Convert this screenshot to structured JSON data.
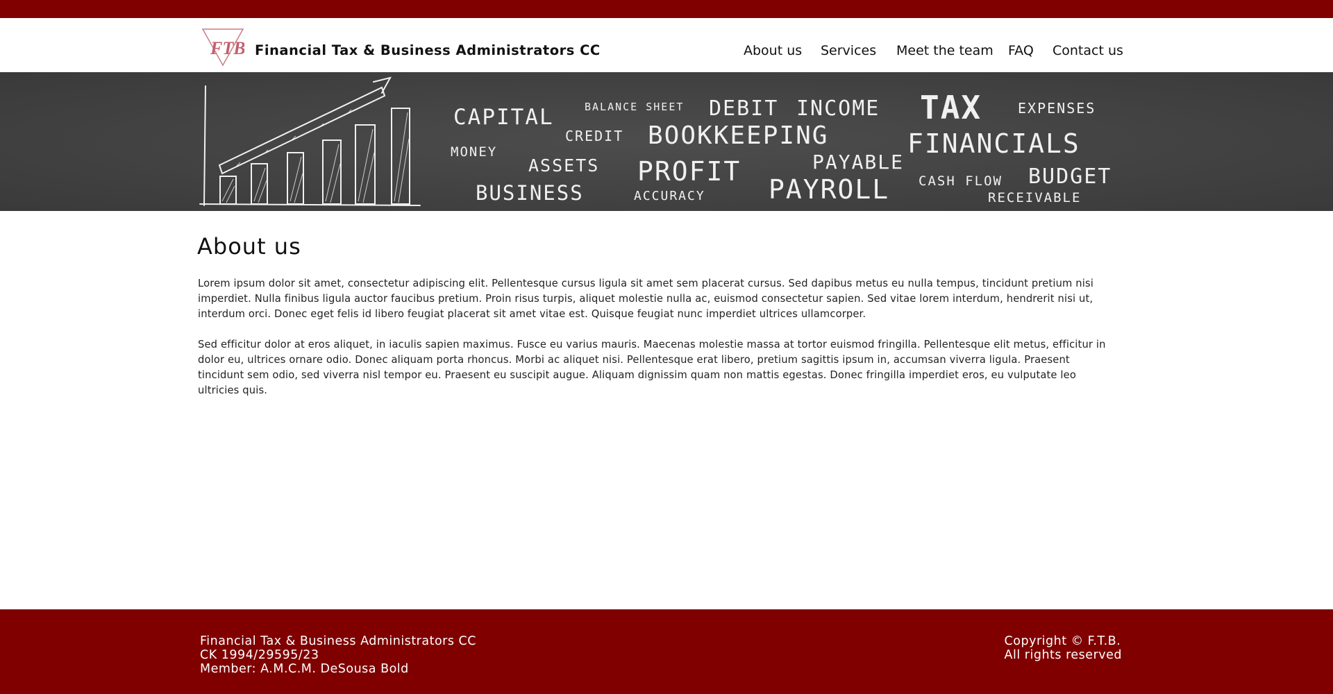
{
  "brand": {
    "logo_text": "FTB",
    "site_title": "Financial Tax & Business Administrators CC",
    "accent_color": "#800000"
  },
  "nav": {
    "items": [
      {
        "label": "About us"
      },
      {
        "label": "Services"
      },
      {
        "label": "Meet the team"
      },
      {
        "label": "FAQ"
      },
      {
        "label": "Contact us"
      }
    ]
  },
  "banner": {
    "words": [
      "CAPITAL",
      "BALANCE SHEET",
      "DEBIT",
      "INCOME",
      "TAX",
      "EXPENSES",
      "CREDIT",
      "BOOKKEEPING",
      "MONEY",
      "FINANCIALS",
      "ASSETS",
      "PROFIT",
      "PAYABLE",
      "BUSINESS",
      "ACCURACY",
      "PAYROLL",
      "CASH FLOW",
      "BUDGET",
      "RECEIVABLE"
    ]
  },
  "main": {
    "title": "About us",
    "paragraphs": [
      "Lorem ipsum dolor sit amet, consectetur adipiscing elit. Pellentesque cursus ligula sit amet sem placerat cursus. Sed dapibus metus eu nulla tempus, tincidunt pretium nisi imperdiet. Nulla finibus ligula auctor faucibus pretium. Proin risus turpis, aliquet molestie nulla ac, euismod consectetur sapien. Sed vitae lorem interdum, hendrerit nisi ut, interdum orci. Donec eget felis id libero feugiat placerat sit amet vitae est. Quisque feugiat nunc imperdiet ultrices ullamcorper.",
      "Sed efficitur dolor at eros aliquet, in iaculis sapien maximus. Fusce eu varius mauris. Maecenas molestie massa at tortor euismod fringilla. Pellentesque elit metus, efficitur in dolor eu, ultrices ornare odio. Donec aliquam porta rhoncus. Morbi ac aliquet nisi. Pellentesque erat libero, pretium sagittis ipsum in, accumsan viverra ligula. Praesent tincidunt sem odio, sed viverra nisl tempor eu. Praesent eu suscipit augue. Aliquam dignissim quam non mattis egestas. Donec fringilla imperdiet eros, eu vulputate leo ultricies quis."
    ]
  },
  "footer": {
    "company": "Financial Tax & Business Administrators CC",
    "reg": "CK 1994/29595/23",
    "member": "Member:  A.M.C.M. DeSousa Bold",
    "copyright": "Copyright © F.T.B.",
    "rights": "All rights reserved"
  }
}
